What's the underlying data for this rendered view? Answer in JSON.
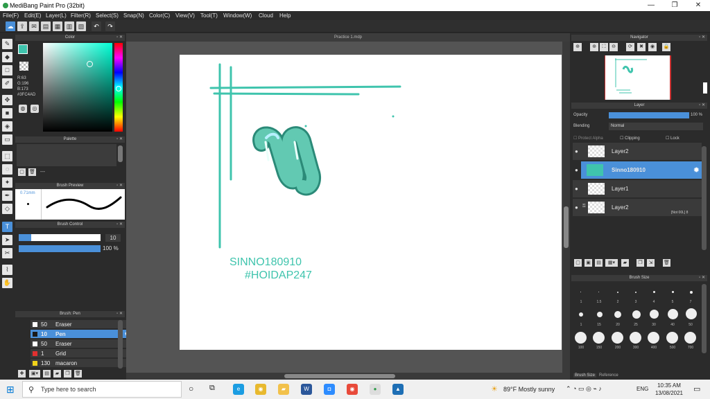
{
  "window": {
    "title": "MediBang Paint Pro (32bit)",
    "minimize": "—",
    "maximize": "❐",
    "close": "✕"
  },
  "menu": [
    "File(F)",
    "Edit(E)",
    "Layer(L)",
    "Filter(R)",
    "Select(S)",
    "Snap(N)",
    "Color(C)",
    "View(V)",
    "Tool(T)",
    "Window(W)",
    "Cloud",
    "Help"
  ],
  "color_panel": {
    "title": "Color",
    "r": "R:63",
    "g": "G:196",
    "b": "B:173",
    "hex": "#3FC4AD",
    "current_color": "#3FC4AD"
  },
  "palette_panel": {
    "title": "Palette",
    "dash": "---"
  },
  "brush_preview": {
    "title": "Brush Preview",
    "size": "0.71mm"
  },
  "brush_control": {
    "title": "Brush Control",
    "size_value": "10",
    "opacity_value": "100 %",
    "size_fraction": 0.15,
    "opacity_fraction": 1.0
  },
  "brush_list": {
    "title": "Brush: Pen",
    "items": [
      {
        "size": "50",
        "name": "Eraser",
        "color": "#ffffff"
      },
      {
        "size": "10",
        "name": "Pen",
        "color": "#1a1a1a"
      },
      {
        "size": "50",
        "name": "Eraser",
        "color": "#ffffff"
      },
      {
        "size": "1",
        "name": "Grid",
        "color": "#e23030"
      },
      {
        "size": "130",
        "name": "macaron",
        "color": "#f1d21a"
      }
    ]
  },
  "document": {
    "tab": "Practice 1.mdp",
    "text_line1": "SINNO180910",
    "text_line2": "#HOIDAP247",
    "ink": "#3FC4AD"
  },
  "navigator": {
    "title": "Navigator"
  },
  "layer_panel": {
    "title": "Layer",
    "opacity_label": "Opacity",
    "opacity_value": "100 %",
    "opacity_fraction": 1.0,
    "blending_label": "Blending",
    "blending_value": "Normal",
    "protect_alpha": "Protect Alpha",
    "clipping": "Clipping",
    "lock": "Lock",
    "layers": [
      {
        "name": "Layer2"
      },
      {
        "name": "Sinno180910"
      },
      {
        "name": "Layer1"
      },
      {
        "name": "Layer2",
        "note": "[Not 00L] 8"
      }
    ]
  },
  "brush_size_panel": {
    "title": "Brush Size",
    "row1": [
      "1",
      "1.5",
      "2",
      "3",
      "4",
      "5",
      "7"
    ],
    "row2": [
      "1",
      "15",
      "20",
      "25",
      "30",
      "40",
      "50"
    ],
    "row3": [
      "100",
      "150",
      "200",
      "300",
      "400",
      "500",
      "700"
    ],
    "tabs": [
      "Brush Size",
      "Reference"
    ]
  },
  "taskbar": {
    "search_placeholder": "Type here to search",
    "weather": "89°F  Mostly sunny",
    "lang": "ENG",
    "time": "10:35 AM",
    "date": "13/08/2021"
  },
  "colors": {
    "accent": "#4a90d9",
    "ink": "#3FC4AD"
  }
}
